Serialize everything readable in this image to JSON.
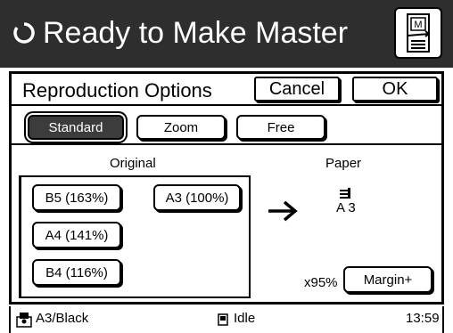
{
  "header": {
    "status": "Ready to Make Master",
    "status_icon": "refresh-circle-icon",
    "master_icon": "master-document-icon"
  },
  "panel": {
    "title": "Reproduction Options",
    "cancel_label": "Cancel",
    "ok_label": "OK",
    "tabs": [
      {
        "label": "Standard",
        "selected": true
      },
      {
        "label": "Zoom",
        "selected": false
      },
      {
        "label": "Free",
        "selected": false
      }
    ],
    "original_label": "Original",
    "paper_label": "Paper",
    "sizes": [
      {
        "label": "B5 (163%)"
      },
      {
        "label": "A3 (100%)"
      },
      {
        "label": "A4 (141%)"
      },
      {
        "label": "B4 (116%)"
      }
    ],
    "paper_size": "A 3",
    "zoom_value": "x95%",
    "margin_label": "Margin+"
  },
  "footer": {
    "paper_info": "A3/Black",
    "status": "Idle",
    "time": "13:59"
  },
  "colors": {
    "header_bg": "#2e2e2e",
    "selected_tab_bg": "#3c3c3c"
  }
}
